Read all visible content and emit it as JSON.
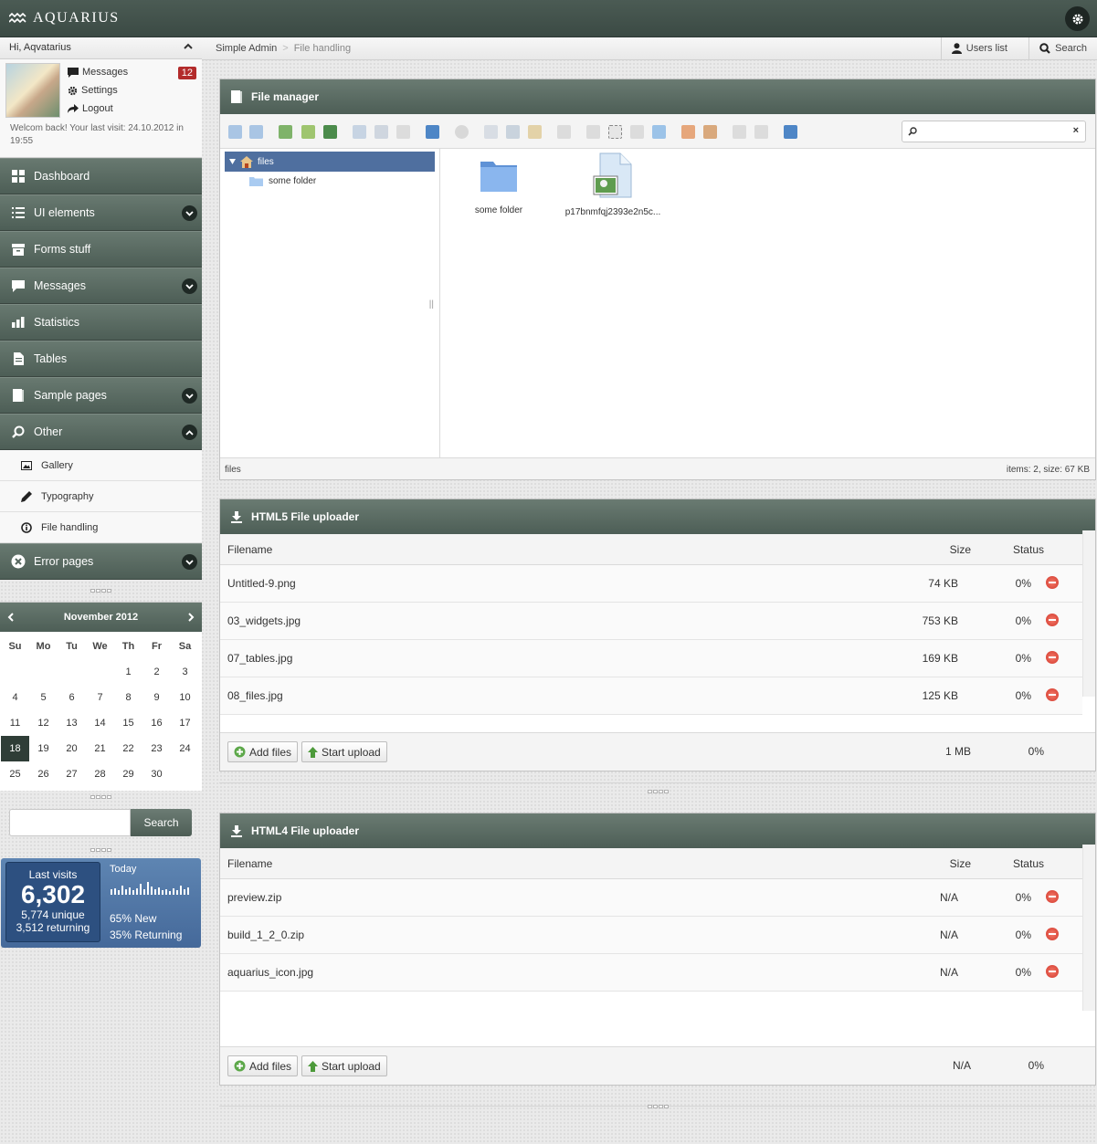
{
  "app": {
    "brand": "AQUARIUS"
  },
  "user": {
    "greeting": "Hi, Aqvatarius",
    "menu": [
      {
        "label": "Messages",
        "icon": "comment-icon"
      },
      {
        "label": "Settings",
        "icon": "gear-icon"
      },
      {
        "label": "Logout",
        "icon": "share-arrow-icon"
      }
    ],
    "messages_count": "12",
    "welcome": "Welcom back! Your last visit: 24.10.2012 in 19:55"
  },
  "sidebar": {
    "items": [
      {
        "label": "Dashboard",
        "icon": "dashboard-icon"
      },
      {
        "label": "UI elements",
        "icon": "list-icon"
      },
      {
        "label": "Forms stuff",
        "icon": "archive-icon"
      },
      {
        "label": "Messages",
        "icon": "comment-icon"
      },
      {
        "label": "Statistics",
        "icon": "bar-chart-icon"
      },
      {
        "label": "Tables",
        "icon": "document-icon"
      },
      {
        "label": "Sample pages",
        "icon": "pages-icon"
      },
      {
        "label": "Other",
        "icon": "search-icon"
      },
      {
        "label": "Error pages",
        "icon": "error-icon"
      }
    ],
    "other_sub": [
      {
        "label": "Gallery",
        "icon": "picture-icon"
      },
      {
        "label": "Typography",
        "icon": "pencil-icon"
      },
      {
        "label": "File handling",
        "icon": "info-circle-icon"
      }
    ]
  },
  "calendar": {
    "month": "November 2012",
    "day_names": [
      "Su",
      "Mo",
      "Tu",
      "We",
      "Th",
      "Fr",
      "Sa"
    ],
    "today": "18",
    "days": [
      "",
      "",
      "",
      "",
      "1",
      "2",
      "3",
      "4",
      "5",
      "6",
      "7",
      "8",
      "9",
      "10",
      "11",
      "12",
      "13",
      "14",
      "15",
      "16",
      "17",
      "18",
      "19",
      "20",
      "21",
      "22",
      "23",
      "24",
      "25",
      "26",
      "27",
      "28",
      "29",
      "30",
      ""
    ]
  },
  "side_search": {
    "button": "Search"
  },
  "visits": {
    "title": "Last visits",
    "total": "6,302",
    "unique": "5,774 unique",
    "returning": "3,512 returning",
    "today_label": "Today",
    "new_pct": "65% New",
    "returning_pct": "35% Returning"
  },
  "breadcrumb": {
    "root": "Simple Admin",
    "sep": ">",
    "current": "File handling"
  },
  "top_actions": {
    "users": "Users list",
    "search": "Search"
  },
  "file_manager": {
    "title": "File manager",
    "tree_root": "files",
    "tree_child": "some folder",
    "items": [
      {
        "name": "some folder",
        "type": "folder"
      },
      {
        "name": "p17bnmfqj2393e2n5c...",
        "type": "image"
      }
    ],
    "status_path": "files",
    "status_info": "items: 2, size: 67 KB"
  },
  "html5_uploader": {
    "title": "HTML5 File uploader",
    "headers": {
      "filename": "Filename",
      "size": "Size",
      "status": "Status"
    },
    "files": [
      {
        "name": "Untitled-9.png",
        "size": "74 KB",
        "status": "0%"
      },
      {
        "name": "03_widgets.jpg",
        "size": "753 KB",
        "status": "0%"
      },
      {
        "name": "07_tables.jpg",
        "size": "169 KB",
        "status": "0%"
      },
      {
        "name": "08_files.jpg",
        "size": "125 KB",
        "status": "0%"
      }
    ],
    "add_label": "Add files",
    "start_label": "Start upload",
    "total_size": "1 MB",
    "total_status": "0%"
  },
  "html4_uploader": {
    "title": "HTML4 File uploader",
    "headers": {
      "filename": "Filename",
      "size": "Size",
      "status": "Status"
    },
    "files": [
      {
        "name": "preview.zip",
        "size": "N/A",
        "status": "0%"
      },
      {
        "name": "build_1_2_0.zip",
        "size": "N/A",
        "status": "0%"
      },
      {
        "name": "aquarius_icon.jpg",
        "size": "N/A",
        "status": "0%"
      }
    ],
    "add_label": "Add files",
    "start_label": "Start upload",
    "total_size": "N/A",
    "total_status": "0%"
  },
  "colors": {
    "header": "#4d5e56",
    "accent_blue": "#4f6f9f",
    "badge": "#b32b2b"
  }
}
